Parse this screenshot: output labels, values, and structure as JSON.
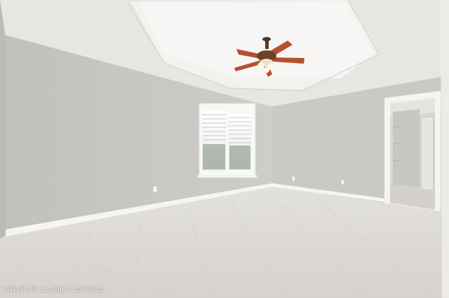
{
  "watermark": {
    "text": "WRVBOR Listing # 1079710"
  },
  "colors": {
    "ceiling": "#e9e8e5",
    "tray": "#f1f0ed",
    "wall_left": "#c9c7c3",
    "wall_back": "#cfcdc9",
    "carpet": "#dedbd7",
    "trim": "#f7f6f3",
    "fan_blade": "#b5502f",
    "fan_body": "#5a3a22"
  }
}
